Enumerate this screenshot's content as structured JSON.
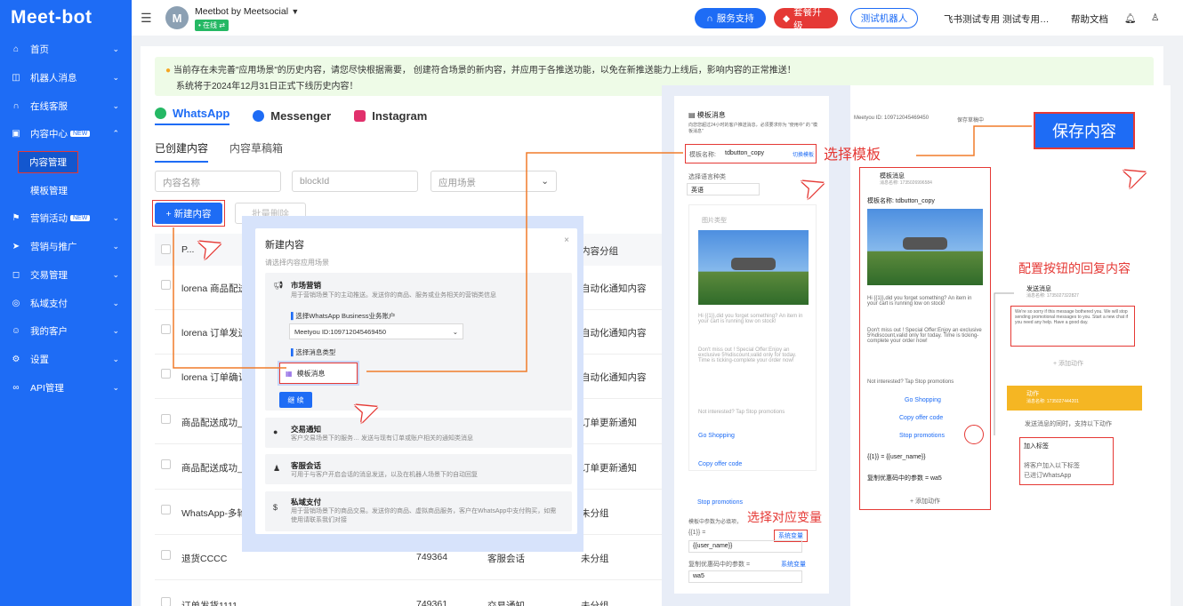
{
  "app": {
    "logo": "Meet-bot"
  },
  "sidebar": {
    "items": [
      {
        "label": "首页"
      },
      {
        "label": "机器人消息"
      },
      {
        "label": "在线客服"
      },
      {
        "label": "内容中心",
        "badge": "NEW"
      },
      {
        "label": "内容管理"
      },
      {
        "label": "模板管理"
      },
      {
        "label": "营销活动",
        "badge": "NEW"
      },
      {
        "label": "营销与推广"
      },
      {
        "label": "交易管理"
      },
      {
        "label": "私域支付"
      },
      {
        "label": "我的客户"
      },
      {
        "label": "设置"
      },
      {
        "label": "API管理"
      }
    ]
  },
  "header": {
    "avatar_letter": "M",
    "account_name": "Meetbot by Meetsocial",
    "status": "• 在线 ⇄",
    "service_support": "服务支持",
    "upgrade": "套餐升级",
    "test_robot": "测试机器人",
    "feishu": "飞书测试专用",
    "test_user": "测试专用…",
    "help": "帮助文档"
  },
  "notice": {
    "line1": "当前存在未完善\"应用场景\"的历史内容，请您尽快根据需要， 创建符合场景的新内容，并应用于各推送功能，以免在新推送能力上线后，影响内容的正常推送！",
    "line2": "系统将于2024年12月31日正式下线历史内容！"
  },
  "channels": [
    "WhatsApp",
    "Messenger",
    "Instagram"
  ],
  "subtabs": [
    "已创建内容",
    "内容草稿箱"
  ],
  "filters": {
    "name": "内容名称",
    "block": "blockId",
    "scene": "应用场景"
  },
  "actions": {
    "add": "+ 新建内容",
    "batch_delete": "批量删除"
  },
  "table": {
    "col_name_head": "P...",
    "col_group_head": "内容分组",
    "rows": [
      {
        "name": "lorena 商品配送",
        "id": "",
        "scene": "",
        "group": "自动化通知内容"
      },
      {
        "name": "lorena 订单发送",
        "id": "",
        "scene": "",
        "group": "自动化通知内容"
      },
      {
        "name": "lorena 订单确认",
        "id": "",
        "scene": "",
        "group": "自动化通知内容"
      },
      {
        "name": "商品配送成功_4",
        "id": "",
        "scene": "",
        "group": "订单更新通知"
      },
      {
        "name": "商品配送成功_",
        "id": "",
        "scene": "",
        "group": "订单更新通知"
      },
      {
        "name": "WhatsApp-多轮",
        "id": "",
        "scene": "",
        "group": "未分组"
      },
      {
        "name": "退货CCCC",
        "id": "749364",
        "scene": "客服会话",
        "group": "未分组"
      },
      {
        "name": "订单发货1111",
        "id": "749361",
        "scene": "交易通知",
        "group": "未分组"
      }
    ]
  },
  "modal": {
    "title": "新建内容",
    "subtitle": "请选择内容应用场景",
    "close": "×",
    "marketing_title": "市场营销",
    "marketing_desc": "用于营销场景下的主动推送。发送你的商品、服务或业务相关的营销类信息",
    "account_label": "选择WhatsApp Business业务账户",
    "account_value": "Meetyou ID:109712045469450",
    "type_label": "选择消息类型",
    "type_value": "模板消息",
    "continue": "继 续",
    "trade_title": "交易通知",
    "trade_desc": "客户交易场景下的服务… 发送与现有订单或账户相关的通知类消息",
    "service_title": "客服会话",
    "service_desc": "可用于与客户开启会话的消息发送，以及在机器人场景下的自动回复",
    "pay_title": "私域支付",
    "pay_desc": "用于营销场景下的商品交易。发送你的商品、虚拟商品服务，客户在WhatsApp中支付购买，如需使用请联系我们对接"
  },
  "overlay": {
    "select_template": "选择模板",
    "save": "保存内容",
    "config_reply": "配置按钮的回复内容",
    "select_var": "选择对应变量",
    "panel_title": "模板消息",
    "panel_desc": "向您您超过24小时的客户推送消息，必须要求你为 \"使用中\" 的 \"模板消息\"",
    "template_name_label": "模板名称:",
    "template_name": "tdbutton_copy",
    "switch_template": "切换模板",
    "lang_label": "选择语言种类",
    "lang_value": "英语",
    "image_type": "图片类型",
    "msg_body": "Hi {{1}},did you forget something? An item in your cart is running low on stock!",
    "msg_body2": "Don't miss out ! Special Offer:Enjoy an exclusive 5%discount,valid only for today. Time is ticking-complete your order now!",
    "not_interested": "Not interested? Tap Stop promotions",
    "btn1": "Go Shopping",
    "btn2": "Copy offer code",
    "btn3": "Stop promotions",
    "var_hint": "模板中参数为必填项，",
    "var1": "{{1}} =",
    "var1_link": "系统变量",
    "var1_value": "{{user_name}}",
    "var2": "复制优惠码中的参数 =",
    "var2_link": "系统变量",
    "var2_value": "wa5",
    "node_title": "模板消息",
    "node_id": "消息名称: 1735026996584",
    "node_template": "模板名称: tdbutton_copy",
    "map1": "{{1}} = {{user_name}}",
    "map2": "复制优惠码中的参数 = wa5",
    "add_action": "+ 添加动作",
    "send_title": "发送消息",
    "send_id": "消息名称: 1735027322827",
    "send_text": "We're so sorry if this message bothered you. We will stop sending promotional messages to you. Start a new chat if you need any help. Have a good day.",
    "add_msg": "+ 添加动作",
    "action_title": "动作",
    "action_id": "消息名称: 1735027444201",
    "action_hint": "发送消息的同时，支持以下动作",
    "tag_title": "加入标签",
    "tag_text": "将客户加入以下标签",
    "tag_value": "已进订WhatsApp",
    "topbar_account": "Meetyou ID: 109712045469450",
    "topbar_saving": "保存草稿中"
  }
}
